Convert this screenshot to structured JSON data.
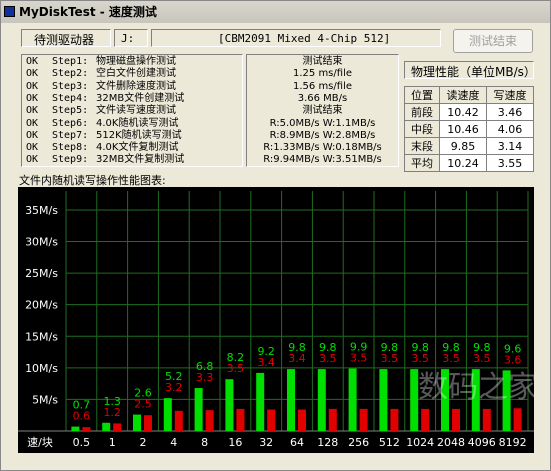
{
  "window": {
    "title": "MyDiskTest - 速度测试"
  },
  "header": {
    "drive_label": "待测驱动器",
    "drive_letter": "J:",
    "device_name": "[CBM2091 Mixed 4-Chip 512]",
    "finish_button": "测试结束"
  },
  "steps": [
    {
      "status": "OK",
      "step": "Step1:",
      "name": "物理磁盘操作测试"
    },
    {
      "status": "OK",
      "step": "Step2:",
      "name": "空白文件创建测试"
    },
    {
      "status": "OK",
      "step": "Step3:",
      "name": "文件删除速度测试"
    },
    {
      "status": "OK",
      "step": "Step4:",
      "name": "32MB文件创建测试"
    },
    {
      "status": "OK",
      "step": "Step5:",
      "name": "文件读写速度测试"
    },
    {
      "status": "OK",
      "step": "Step6:",
      "name": "4.0K随机读写测试"
    },
    {
      "status": "OK",
      "step": "Step7:",
      "name": "512K随机读写测试"
    },
    {
      "status": "OK",
      "step": "Step8:",
      "name": "4.0K文件复制测试"
    },
    {
      "status": "OK",
      "step": "Step9:",
      "name": "32MB文件复制测试"
    }
  ],
  "results": [
    "测试结束",
    "1.25 ms/file",
    "1.56 ms/file",
    "3.66 MB/s",
    "测试结束",
    "R:5.0MB/s W:1.1MB/s",
    "R:8.9MB/s W:2.8MB/s",
    "R:1.33MB/s W:0.18MB/s",
    "R:9.94MB/s W:3.51MB/s"
  ],
  "perf": {
    "title": "物理性能（单位MB/s）",
    "headers": [
      "位置",
      "读速度",
      "写速度"
    ],
    "rows": [
      [
        "前段",
        "10.42",
        "3.46"
      ],
      [
        "中段",
        "10.46",
        "4.06"
      ],
      [
        "末段",
        "9.85",
        "3.14"
      ],
      [
        "平均",
        "10.24",
        "3.55"
      ]
    ]
  },
  "chart_title": "文件内随机读写操作性能图表:",
  "chart_data": {
    "type": "bar",
    "xlabel": "速/块",
    "categories": [
      "0.5",
      "1",
      "2",
      "4",
      "8",
      "16",
      "32",
      "64",
      "128",
      "256",
      "512",
      "1024",
      "2048",
      "4096",
      "8192"
    ],
    "series": [
      {
        "name": "",
        "color": "#00e000",
        "values": [
          0.7,
          1.3,
          2.6,
          5.2,
          6.8,
          8.2,
          9.2,
          9.8,
          9.8,
          9.9,
          9.8,
          9.8,
          9.8,
          9.8,
          9.6
        ]
      },
      {
        "name": "",
        "color": "#e00000",
        "values": [
          0.6,
          1.2,
          2.5,
          3.2,
          3.3,
          3.5,
          3.4,
          3.4,
          3.5,
          3.5,
          3.5,
          3.5,
          3.5,
          3.5,
          3.6
        ]
      }
    ],
    "yticks": [
      "5M/s",
      "10M/s",
      "15M/s",
      "20M/s",
      "25M/s",
      "30M/s",
      "35M/s"
    ],
    "ylim": [
      0,
      38
    ],
    "grid": true,
    "watermark": "数码之家"
  }
}
